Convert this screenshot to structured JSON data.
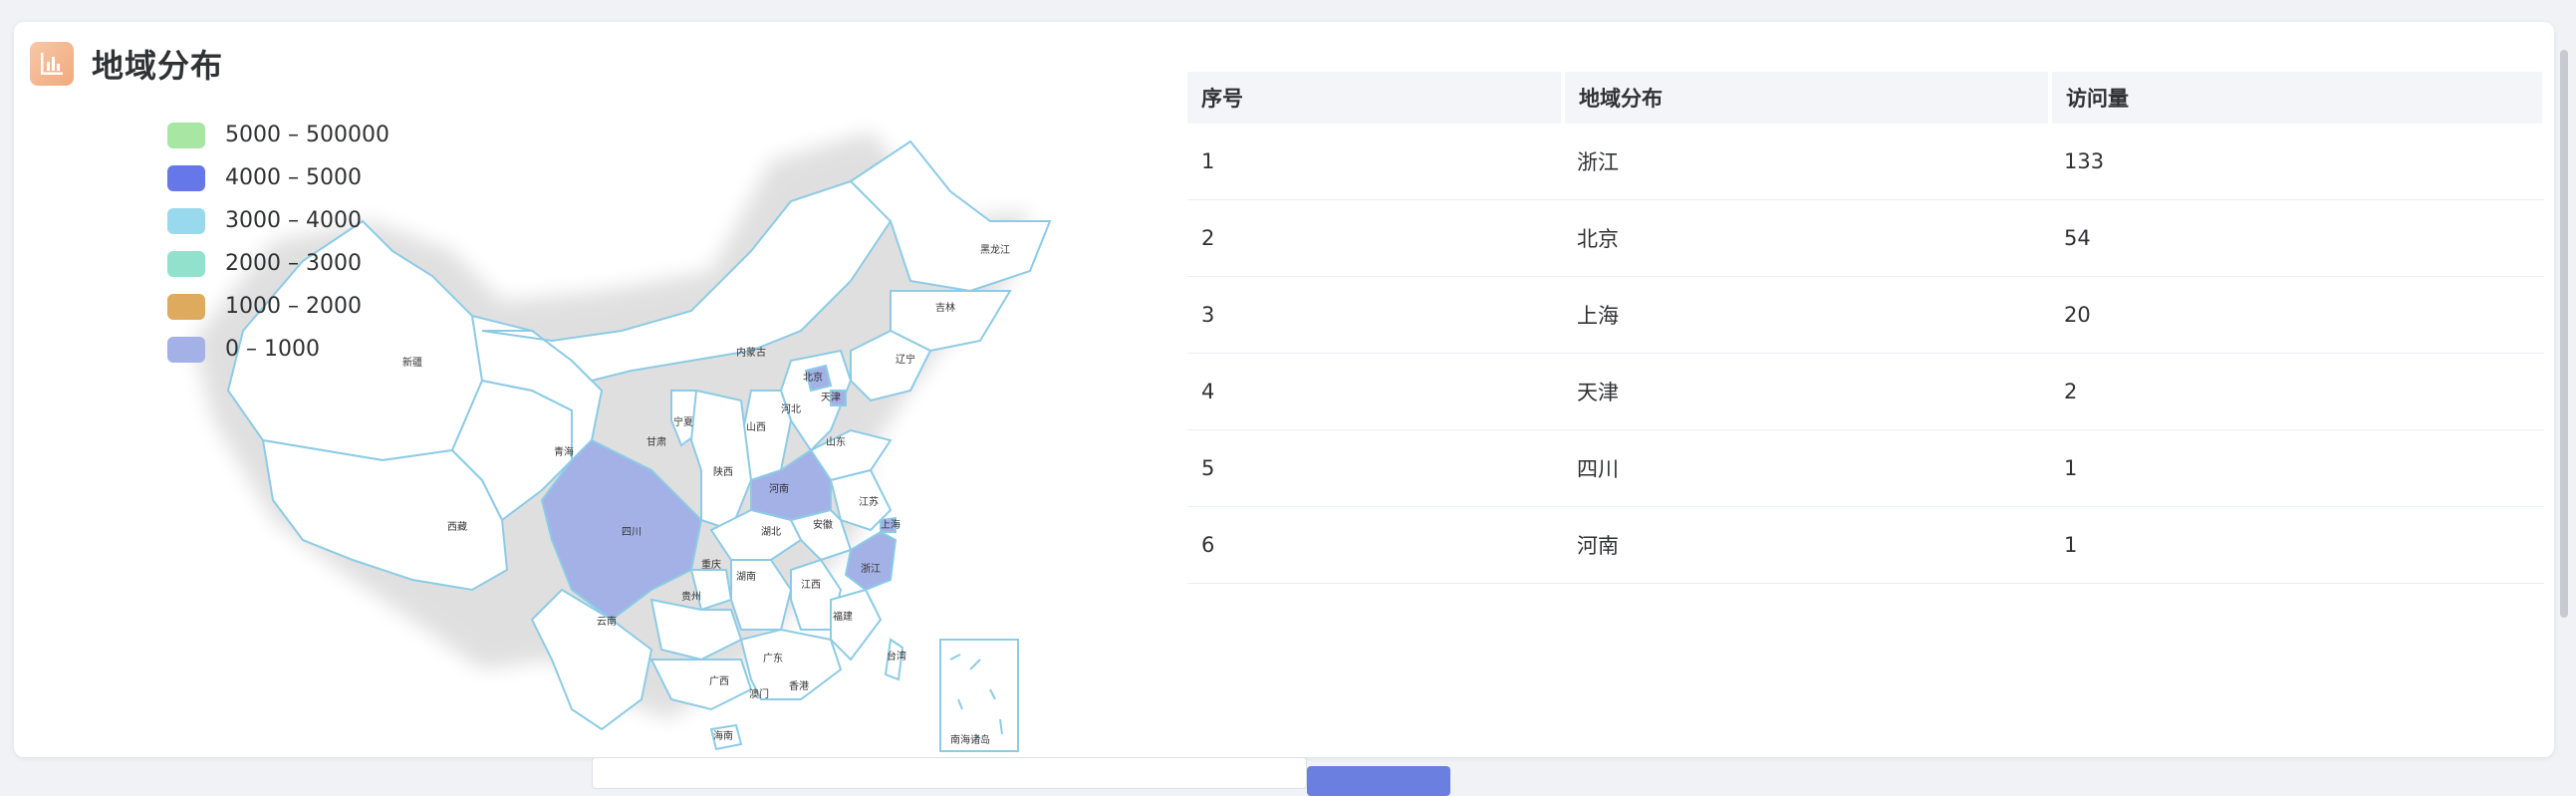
{
  "card": {
    "title": "地域分布",
    "icon": "bar-chart-icon"
  },
  "legend": [
    {
      "label": "5000 – 500000",
      "color": "#a8e6a3"
    },
    {
      "label": "4000 – 5000",
      "color": "#6677ea"
    },
    {
      "label": "3000 – 4000",
      "color": "#98d9ee"
    },
    {
      "label": "2000 – 3000",
      "color": "#92e1cc"
    },
    {
      "label": "1000 – 2000",
      "color": "#deaa5e"
    },
    {
      "label": "0 – 1000",
      "color": "#a3b1e6"
    }
  ],
  "map": {
    "provinces": [
      "黑龙江",
      "吉林",
      "辽宁",
      "内蒙古",
      "北京",
      "天津",
      "河北",
      "山西",
      "山东",
      "宁夏",
      "甘肃",
      "青海",
      "新疆",
      "西藏",
      "陕西",
      "河南",
      "江苏",
      "上海",
      "安徽",
      "湖北",
      "四川",
      "重庆",
      "浙江",
      "湖南",
      "江西",
      "贵州",
      "福建",
      "云南",
      "广西",
      "广东",
      "台湾",
      "香港",
      "澳门",
      "海南",
      "南海诸岛"
    ],
    "highlight_color": "#a3b1e6"
  },
  "table": {
    "headers": [
      "序号",
      "地域分布",
      "访问量"
    ],
    "rows": [
      {
        "index": "1",
        "region": "浙江",
        "visits": "133"
      },
      {
        "index": "2",
        "region": "北京",
        "visits": "54"
      },
      {
        "index": "3",
        "region": "上海",
        "visits": "20"
      },
      {
        "index": "4",
        "region": "天津",
        "visits": "2"
      },
      {
        "index": "5",
        "region": "四川",
        "visits": "1"
      },
      {
        "index": "6",
        "region": "河南",
        "visits": "1"
      }
    ]
  }
}
